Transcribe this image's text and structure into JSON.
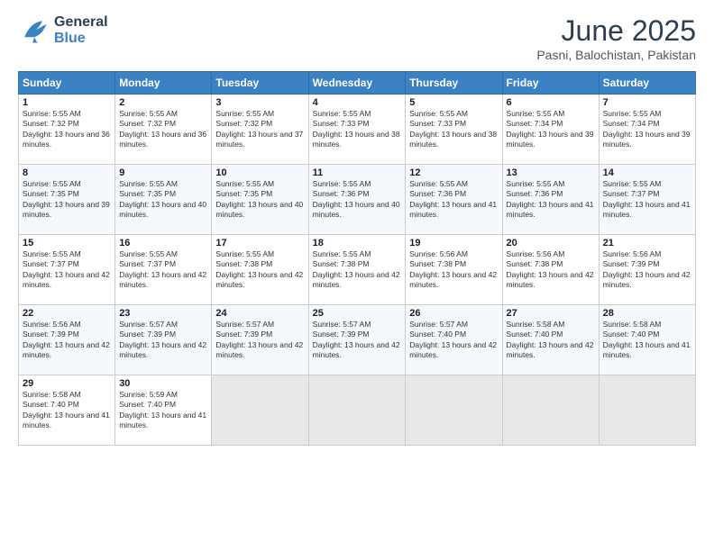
{
  "header": {
    "logo": {
      "general": "General",
      "blue": "Blue"
    },
    "title": "June 2025",
    "location": "Pasni, Balochistan, Pakistan"
  },
  "days_of_week": [
    "Sunday",
    "Monday",
    "Tuesday",
    "Wednesday",
    "Thursday",
    "Friday",
    "Saturday"
  ],
  "weeks": [
    [
      {
        "day": 1,
        "sunrise": "5:55 AM",
        "sunset": "7:32 PM",
        "daylight": "13 hours and 36 minutes."
      },
      {
        "day": 2,
        "sunrise": "5:55 AM",
        "sunset": "7:32 PM",
        "daylight": "13 hours and 36 minutes."
      },
      {
        "day": 3,
        "sunrise": "5:55 AM",
        "sunset": "7:32 PM",
        "daylight": "13 hours and 37 minutes."
      },
      {
        "day": 4,
        "sunrise": "5:55 AM",
        "sunset": "7:33 PM",
        "daylight": "13 hours and 38 minutes."
      },
      {
        "day": 5,
        "sunrise": "5:55 AM",
        "sunset": "7:33 PM",
        "daylight": "13 hours and 38 minutes."
      },
      {
        "day": 6,
        "sunrise": "5:55 AM",
        "sunset": "7:34 PM",
        "daylight": "13 hours and 39 minutes."
      },
      {
        "day": 7,
        "sunrise": "5:55 AM",
        "sunset": "7:34 PM",
        "daylight": "13 hours and 39 minutes."
      }
    ],
    [
      {
        "day": 8,
        "sunrise": "5:55 AM",
        "sunset": "7:35 PM",
        "daylight": "13 hours and 39 minutes."
      },
      {
        "day": 9,
        "sunrise": "5:55 AM",
        "sunset": "7:35 PM",
        "daylight": "13 hours and 40 minutes."
      },
      {
        "day": 10,
        "sunrise": "5:55 AM",
        "sunset": "7:35 PM",
        "daylight": "13 hours and 40 minutes."
      },
      {
        "day": 11,
        "sunrise": "5:55 AM",
        "sunset": "7:36 PM",
        "daylight": "13 hours and 40 minutes."
      },
      {
        "day": 12,
        "sunrise": "5:55 AM",
        "sunset": "7:36 PM",
        "daylight": "13 hours and 41 minutes."
      },
      {
        "day": 13,
        "sunrise": "5:55 AM",
        "sunset": "7:36 PM",
        "daylight": "13 hours and 41 minutes."
      },
      {
        "day": 14,
        "sunrise": "5:55 AM",
        "sunset": "7:37 PM",
        "daylight": "13 hours and 41 minutes."
      }
    ],
    [
      {
        "day": 15,
        "sunrise": "5:55 AM",
        "sunset": "7:37 PM",
        "daylight": "13 hours and 42 minutes."
      },
      {
        "day": 16,
        "sunrise": "5:55 AM",
        "sunset": "7:37 PM",
        "daylight": "13 hours and 42 minutes."
      },
      {
        "day": 17,
        "sunrise": "5:55 AM",
        "sunset": "7:38 PM",
        "daylight": "13 hours and 42 minutes."
      },
      {
        "day": 18,
        "sunrise": "5:55 AM",
        "sunset": "7:38 PM",
        "daylight": "13 hours and 42 minutes."
      },
      {
        "day": 19,
        "sunrise": "5:56 AM",
        "sunset": "7:38 PM",
        "daylight": "13 hours and 42 minutes."
      },
      {
        "day": 20,
        "sunrise": "5:56 AM",
        "sunset": "7:38 PM",
        "daylight": "13 hours and 42 minutes."
      },
      {
        "day": 21,
        "sunrise": "5:56 AM",
        "sunset": "7:39 PM",
        "daylight": "13 hours and 42 minutes."
      }
    ],
    [
      {
        "day": 22,
        "sunrise": "5:56 AM",
        "sunset": "7:39 PM",
        "daylight": "13 hours and 42 minutes."
      },
      {
        "day": 23,
        "sunrise": "5:57 AM",
        "sunset": "7:39 PM",
        "daylight": "13 hours and 42 minutes."
      },
      {
        "day": 24,
        "sunrise": "5:57 AM",
        "sunset": "7:39 PM",
        "daylight": "13 hours and 42 minutes."
      },
      {
        "day": 25,
        "sunrise": "5:57 AM",
        "sunset": "7:39 PM",
        "daylight": "13 hours and 42 minutes."
      },
      {
        "day": 26,
        "sunrise": "5:57 AM",
        "sunset": "7:40 PM",
        "daylight": "13 hours and 42 minutes."
      },
      {
        "day": 27,
        "sunrise": "5:58 AM",
        "sunset": "7:40 PM",
        "daylight": "13 hours and 42 minutes."
      },
      {
        "day": 28,
        "sunrise": "5:58 AM",
        "sunset": "7:40 PM",
        "daylight": "13 hours and 41 minutes."
      }
    ],
    [
      {
        "day": 29,
        "sunrise": "5:58 AM",
        "sunset": "7:40 PM",
        "daylight": "13 hours and 41 minutes."
      },
      {
        "day": 30,
        "sunrise": "5:59 AM",
        "sunset": "7:40 PM",
        "daylight": "13 hours and 41 minutes."
      },
      null,
      null,
      null,
      null,
      null
    ]
  ]
}
